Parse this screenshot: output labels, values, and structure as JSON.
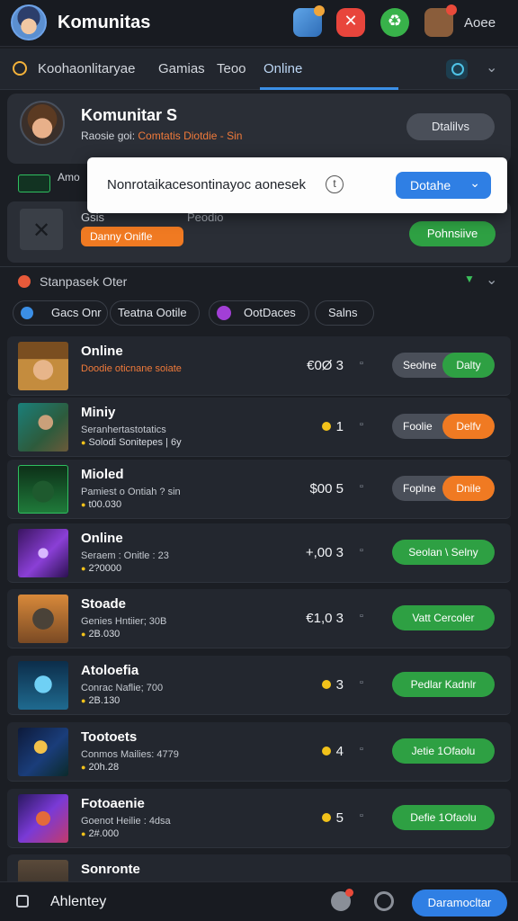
{
  "header": {
    "title": "Komunitas",
    "right_label": "Aoee",
    "icons": [
      "gift-icon",
      "close-badge-icon",
      "recycle-icon",
      "bag-icon"
    ]
  },
  "tabs": {
    "items": [
      "Koohaonlitaryae",
      "Gamias",
      "Teoo",
      "Online"
    ],
    "active": "Online"
  },
  "profile": {
    "name": "Komunitar S",
    "status_prefix": "Raosie goi:",
    "status_highlight": "Comtatis Diotdie - Sin",
    "button": "Dtalilvs"
  },
  "mini_row": {
    "label": "Amo"
  },
  "popup": {
    "text": "Nonrotaikacesontinayoc aonesek",
    "info": "t",
    "button": "Dotahe"
  },
  "game_card": {
    "label": "Gsis",
    "label2": "Peodio",
    "pill": "Danny Onifle",
    "button": "Pohnsiive"
  },
  "section": {
    "title": "Stanpasek Oter"
  },
  "filters": [
    "Gacs Onr",
    "Teatna Ootile",
    "OotDaces",
    "Salns"
  ],
  "rows": [
    {
      "title": "Online",
      "sub": "Doodie oticnane soiate",
      "sub_orange": true,
      "sub2": "",
      "price": "€0Ø 3",
      "dot": "▫",
      "control": "toggle",
      "left": "Seolne",
      "right": "Dalty",
      "right_color": "green"
    },
    {
      "title": "Miniy",
      "sub": "Seranhertastotatics",
      "sub_orange": false,
      "sub2": "Solodi Sonitepes | 6y",
      "price": "1",
      "coin": true,
      "dot": "▫",
      "control": "toggle",
      "left": "Foolie",
      "right": "Delfv",
      "right_color": "orange"
    },
    {
      "title": "Mioled",
      "sub": "Pamiest o Ontiah ? sin",
      "sub_orange": false,
      "sub2": "t00.030",
      "price": "$00 5",
      "dot": "▫",
      "control": "toggle",
      "left": "Foplne",
      "right": "Dnile",
      "right_color": "orange"
    },
    {
      "title": "Online",
      "sub": "Seraem : Onitle : 23",
      "sub_orange": false,
      "sub2": "2?0000",
      "price": "+,00 3",
      "dot": "▫",
      "control": "pill",
      "pill": "Seolan \\ Selny"
    },
    {
      "title": "Stoade",
      "sub": "Genies Hntiier; 30B",
      "sub_orange": false,
      "sub2": "2B.030",
      "price": "€1,0 3",
      "dot": "▫",
      "control": "pill",
      "pill": "Vatt Cercoler"
    },
    {
      "title": "Atoloefia",
      "sub": "Conrac Naflie; 700",
      "sub_orange": false,
      "sub2": "2B.130",
      "price": "3",
      "coin": true,
      "dot": "▫",
      "control": "pill",
      "pill": "Pedlar Kadnlr"
    },
    {
      "title": "Tootoets",
      "sub": "Conmos Mailies: 4779",
      "sub_orange": false,
      "sub2": "20h.28",
      "price": "4",
      "coin": true,
      "dot": "▫",
      "control": "pill",
      "pill": "Jetie 1Ofaolu"
    },
    {
      "title": "Fotoaenie",
      "sub": "Goenot Heilie : 4dsa",
      "sub_orange": false,
      "sub2": "2#.000",
      "price": "5",
      "coin": true,
      "dot": "▫",
      "control": "pill",
      "pill": "Defie 1Ofaolu"
    },
    {
      "title": "Sonronte",
      "sub": "",
      "sub_orange": false,
      "sub2": "",
      "price": "",
      "dot": "",
      "control": "none"
    }
  ],
  "bottombar": {
    "title": "Ahlentey",
    "button": "Daramocltar"
  }
}
